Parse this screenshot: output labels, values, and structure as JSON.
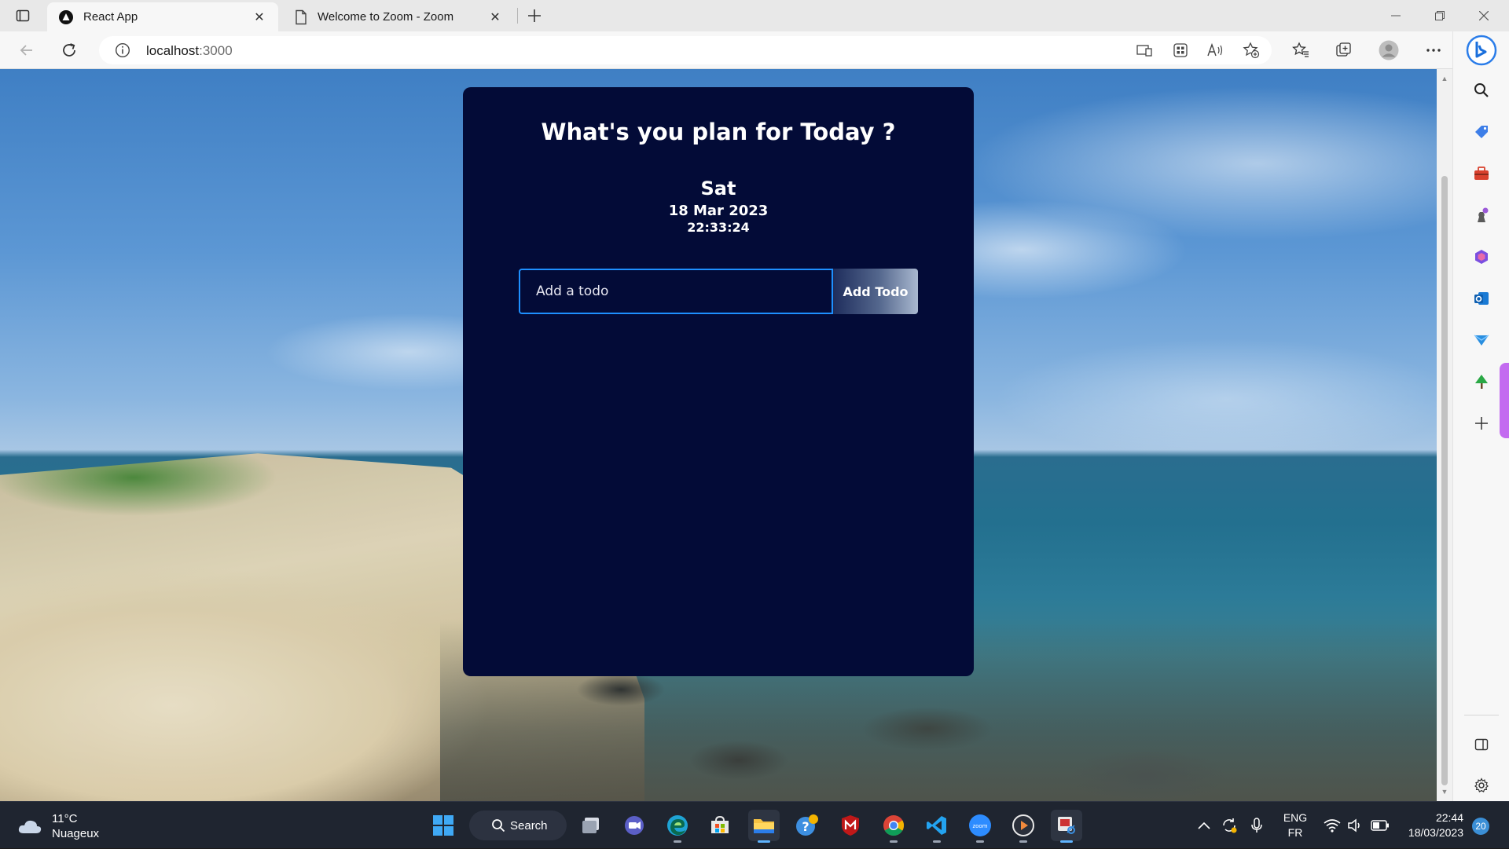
{
  "browser": {
    "tabs": [
      {
        "title": "React App",
        "active": true,
        "icon": "react-app-favicon"
      },
      {
        "title": "Welcome to Zoom - Zoom",
        "active": false,
        "icon": "page-icon"
      }
    ],
    "address": {
      "host": "localhost",
      "port": ":3000"
    },
    "accent_color": "#1e90ff"
  },
  "app": {
    "title": "What's you plan for Today ?",
    "day": "Sat",
    "date": "18 Mar 2023",
    "time": "22:33:24",
    "input_placeholder": "Add a todo",
    "input_value": "",
    "add_button_label": "Add Todo",
    "card_color": "#030b37"
  },
  "sidebar": {
    "items": [
      "search-icon",
      "tag-icon",
      "briefcase-icon",
      "games-icon",
      "office-icon",
      "outlook-icon",
      "send-icon",
      "tree-icon",
      "plus-icon"
    ],
    "bottom": [
      "split-screen-icon",
      "settings-icon"
    ]
  },
  "taskbar": {
    "weather": {
      "temp": "11°C",
      "condition": "Nuageux"
    },
    "search_label": "Search",
    "apps": [
      "windows-start-icon",
      "task-view-icon",
      "teams-icon",
      "edge-icon",
      "store-icon",
      "file-explorer-icon",
      "help-icon",
      "mcafee-icon",
      "chrome-icon",
      "vscode-icon",
      "zoom-icon",
      "media-player-icon",
      "snipping-tool-icon"
    ],
    "lang": {
      "line1": "ENG",
      "line2": "FR"
    },
    "clock": {
      "time": "22:44",
      "date": "18/03/2023"
    },
    "notifications": "20"
  }
}
